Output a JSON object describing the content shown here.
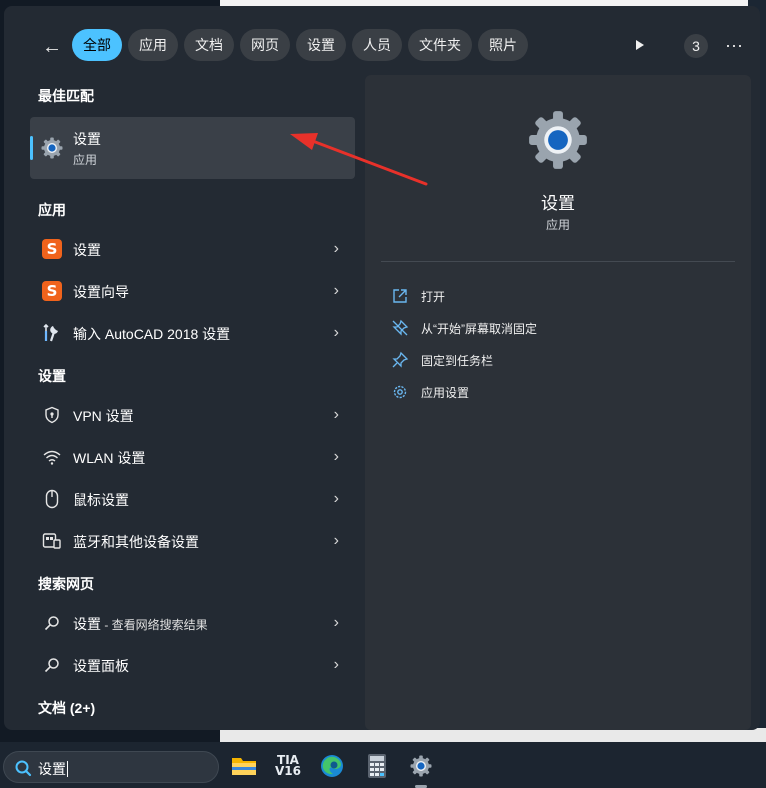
{
  "header": {
    "filters": [
      "全部",
      "应用",
      "文档",
      "网页",
      "设置",
      "人员",
      "文件夹",
      "照片"
    ],
    "active_filter": "全部",
    "badge_count": "3",
    "more_label": "···",
    "back_label": "←"
  },
  "best_match": {
    "section_title": "最佳匹配",
    "name": "设置",
    "type": "应用",
    "icon": "settings-gear-icon"
  },
  "apps": {
    "section_title": "应用",
    "items": [
      {
        "label": "设置",
        "icon": "sogou-s-icon"
      },
      {
        "label": "设置向导",
        "icon": "sogou-s-icon"
      },
      {
        "label": "输入 AutoCAD 2018 设置",
        "icon": "wrench-icon"
      }
    ]
  },
  "settings": {
    "section_title": "设置",
    "items": [
      {
        "label": "VPN 设置",
        "icon": "shield-icon"
      },
      {
        "label": "WLAN 设置",
        "icon": "wifi-icon"
      },
      {
        "label": "鼠标设置",
        "icon": "mouse-icon"
      },
      {
        "label": "蓝牙和其他设备设置",
        "icon": "devices-icon"
      }
    ]
  },
  "web": {
    "section_title": "搜索网页",
    "items": [
      {
        "label": "设置",
        "suffix": " - 查看网络搜索结果",
        "icon": "search-icon"
      },
      {
        "label": "设置面板",
        "icon": "search-icon"
      }
    ]
  },
  "documents": {
    "section_title": "文档 (2+)"
  },
  "chevron": "›",
  "detail": {
    "title": "设置",
    "subtitle": "应用",
    "actions": [
      {
        "label": "打开",
        "icon": "open-external-icon"
      },
      {
        "label": "从“开始”屏幕取消固定",
        "icon": "unpin-icon"
      },
      {
        "label": "固定到任务栏",
        "icon": "pin-icon"
      },
      {
        "label": "应用设置",
        "icon": "gear-icon"
      }
    ]
  },
  "taskbar": {
    "search_value": "设置",
    "apps": [
      "file-explorer-icon",
      "tia-portal-icon",
      "edge-icon",
      "calculator-icon",
      "settings-icon"
    ],
    "tia_label_top": "TIA",
    "tia_label_bottom": "V16"
  },
  "colors": {
    "accent": "#4cc2ff",
    "panel": "#232a33",
    "detail_panel": "#2c3138",
    "annotation_arrow": "#e8312a"
  }
}
